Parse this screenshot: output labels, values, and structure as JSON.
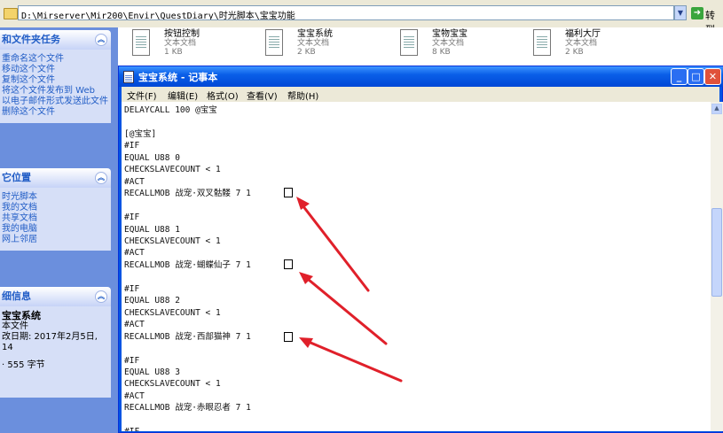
{
  "addressbar": {
    "path": "D:\\Mirserver\\Mir200\\Envir\\QuestDiary\\时光脚本\\宝宝功能",
    "go_icon": "go-arrow-icon",
    "go_label": "转到"
  },
  "taskpane": {
    "file_tasks": {
      "title": "和文件夹任务",
      "items": [
        "重命名这个文件",
        "移动这个文件",
        "复制这个文件",
        "将这个文件发布到 Web",
        "以电子邮件形式发送此文件",
        "删除这个文件"
      ]
    },
    "other_places": {
      "title": "它位置",
      "items": [
        "时光脚本",
        "我的文档",
        "共享文档",
        "我的电脑",
        "网上邻居"
      ]
    },
    "details": {
      "title": "细信息",
      "name": "宝宝系统",
      "type": "本文件",
      "modified": "改日期: 2017年2月5日, 14",
      "size": "· 555 字节"
    }
  },
  "files": [
    {
      "name": "按钮控制",
      "type": "文本文档",
      "size": "1 KB"
    },
    {
      "name": "宝宝系统",
      "type": "文本文档",
      "size": "2 KB"
    },
    {
      "name": "宝物宝宝",
      "type": "文本文档",
      "size": "8 KB"
    },
    {
      "name": "福利大厅",
      "type": "文本文档",
      "size": "2 KB"
    }
  ],
  "notepad": {
    "title": "宝宝系统 - 记事本",
    "menu": [
      "文件(F)",
      "编辑(E)",
      "格式(O)",
      "查看(V)",
      "帮助(H)"
    ],
    "content": "DELAYCALL 100 @宝宝\n\n[@宝宝]\n#IF\nEQUAL U88 0\nCHECKSLAVECOUNT < 1\n#ACT\nRECALLMOB 战宠·双叉骷髅 7 1\n\n#IF\nEQUAL U88 1\nCHECKSLAVECOUNT < 1\n#ACT\nRECALLMOB 战宠·蝴蝶仙子 7 1\n\n#IF\nEQUAL U88 2\nCHECKSLAVECOUNT < 1\n#ACT\nRECALLMOB 战宠·西部猫神 7 1\n\n#IF\nEQUAL U88 3\nCHECKSLAVECOUNT < 1\n#ACT\nRECALLMOB 战宠·赤眼忍者 7 1\n\n#IF",
    "window_buttons": [
      "minimize-icon",
      "maximize-icon",
      "close-icon"
    ]
  },
  "colors": {
    "titlebar": "#0a5fe8",
    "taskpane": "#6b8fdd",
    "annotation": "#e0202a"
  }
}
